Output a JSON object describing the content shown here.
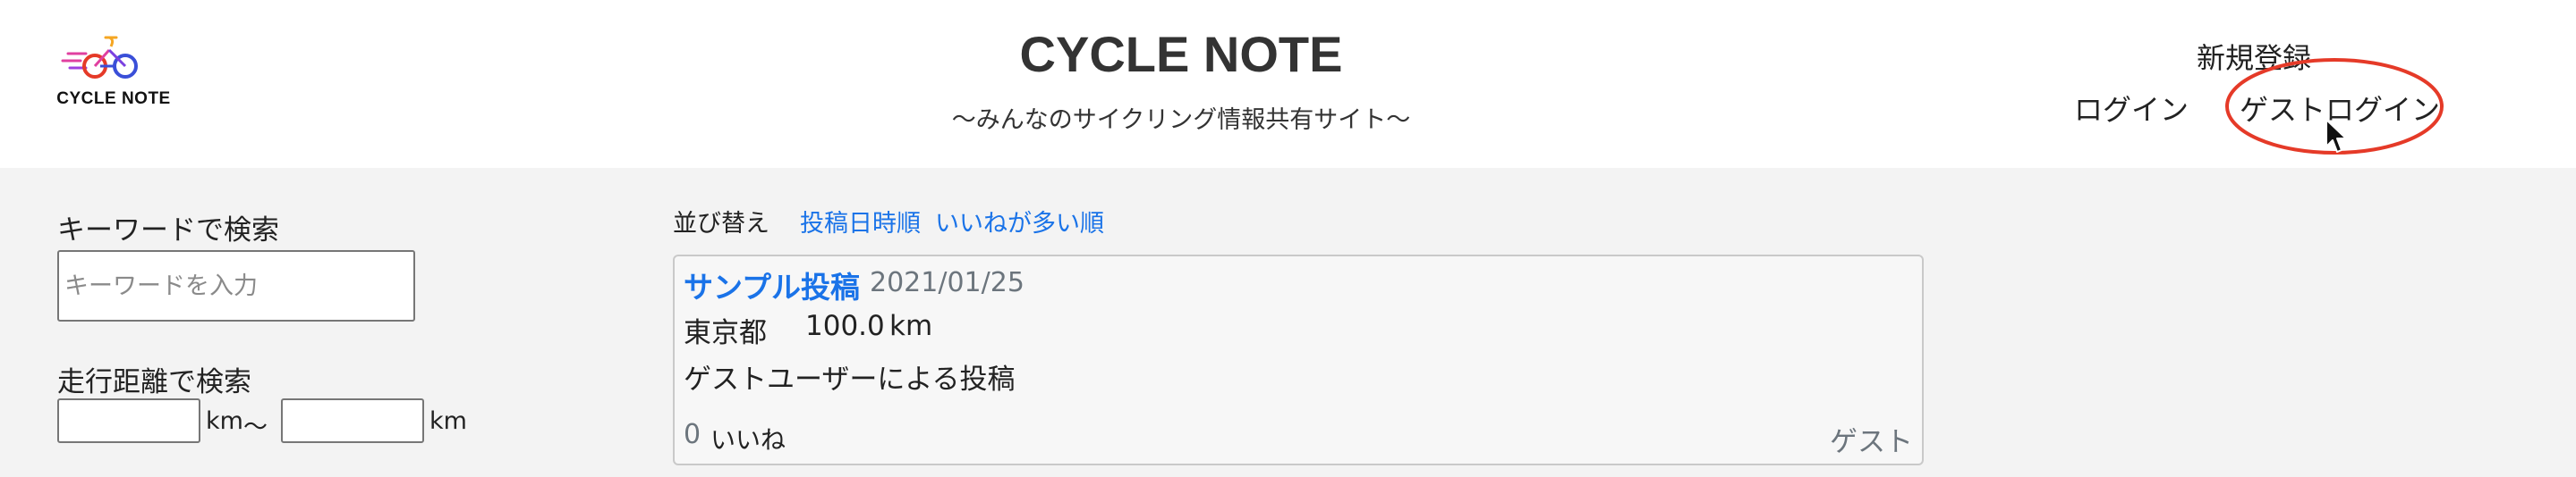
{
  "header": {
    "logo_text": "CYCLE NOTE",
    "title": "CYCLE NOTE",
    "subtitle": "〜みんなのサイクリング情報共有サイト〜",
    "nav": {
      "register": "新規登録",
      "login": "ログイン",
      "guest_login": "ゲストログイン"
    },
    "highlight_color": "#e53a28"
  },
  "search": {
    "keyword_label": "キーワードで検索",
    "keyword_placeholder": "キーワードを入力",
    "distance_label": "走行距離で検索",
    "unit": "km",
    "separator": "〜"
  },
  "sort": {
    "label": "並び替え",
    "by_date": "投稿日時順",
    "by_likes": "いいねが多い順"
  },
  "posts": [
    {
      "title": "サンプル投稿",
      "date": "2021/01/25",
      "location": "東京都",
      "distance": "100.0",
      "distance_unit": "km",
      "body": "ゲストユーザーによる投稿",
      "like_count": "0",
      "like_label": "いいね",
      "author": "ゲスト"
    }
  ],
  "colors": {
    "link": "#1a73e8",
    "muted": "#6c757d",
    "main_background": "#f3f3f3"
  }
}
